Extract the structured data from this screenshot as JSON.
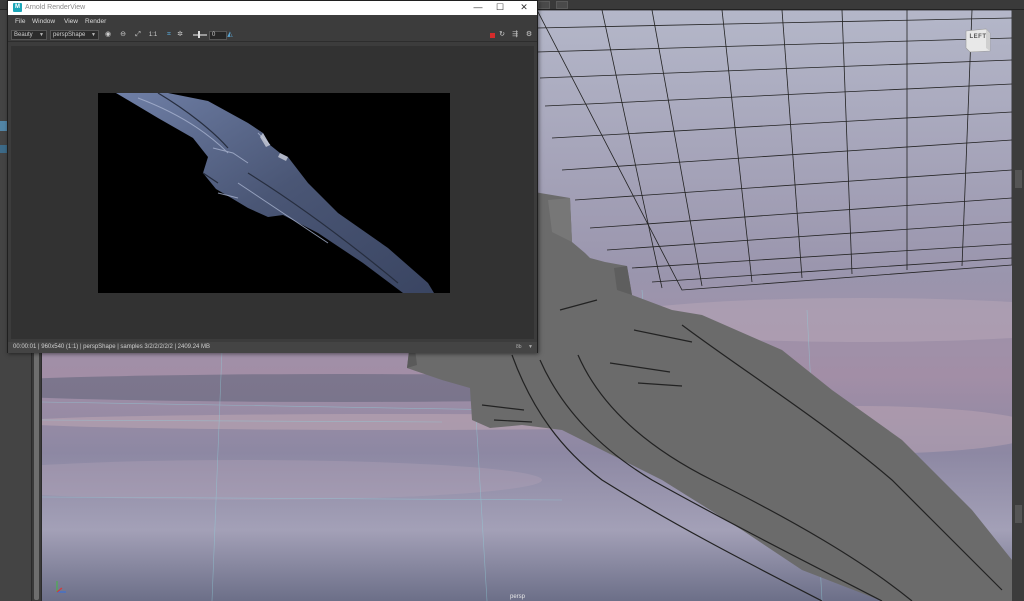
{
  "render_view": {
    "title": "Arnold RenderView",
    "logo_letter": "M",
    "window_controls": {
      "minimize": "—",
      "maximize": "☐",
      "close": "✕"
    },
    "menu": [
      "File",
      "Window",
      "View",
      "Render"
    ],
    "toolbar": {
      "aov_select": "Beauty",
      "camera_select": "perspShape",
      "ratio_label": "1:1",
      "exposure_value": "0"
    },
    "status_text": "00:00:01 | 960x540 (1:1) | perspShape  | samples 3/2/2/2/2/2 | 2409.24 MB",
    "status_right": "8b"
  },
  "viewport": {
    "viewcube_label": "LEFT",
    "camera_label": "persp"
  },
  "colors": {
    "accent": "#1aa6b8",
    "stop": "#d42b2b",
    "model_gray": "#6b6b6b",
    "blade_steel": "#4d5a7a"
  }
}
